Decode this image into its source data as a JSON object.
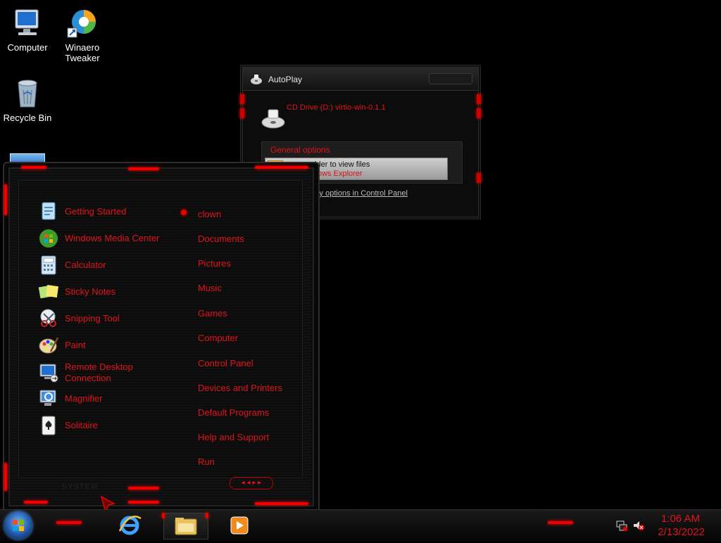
{
  "desktop": {
    "icons": [
      {
        "label": "Computer",
        "icon": "computer-icon"
      },
      {
        "label": "Winaero Tweaker",
        "icon": "winaero-tweaker-icon"
      },
      {
        "label": "Recycle Bin",
        "icon": "recycle-bin-icon"
      }
    ]
  },
  "autoplay": {
    "title": "AutoPlay",
    "drive": "CD Drive (D:) virtio-win-0.1.1",
    "group_title": "General options",
    "option_line1": "older to view files",
    "option_line2": "ows Explorer",
    "control_panel_link": "lay options in Control Panel"
  },
  "start_menu": {
    "programs": [
      {
        "label": "Getting Started",
        "icon": "getting-started-icon"
      },
      {
        "label": "Windows Media Center",
        "icon": "media-center-icon"
      },
      {
        "label": "Calculator",
        "icon": "calculator-icon"
      },
      {
        "label": "Sticky Notes",
        "icon": "sticky-notes-icon"
      },
      {
        "label": "Snipping Tool",
        "icon": "snipping-tool-icon"
      },
      {
        "label": "Paint",
        "icon": "paint-icon"
      },
      {
        "label": "Remote Desktop",
        "label2": "Connection",
        "icon": "remote-desktop-icon"
      },
      {
        "label": "Magnifier",
        "icon": "magnifier-icon"
      },
      {
        "label": "Solitaire",
        "icon": "solitaire-icon"
      }
    ],
    "places": [
      "clown",
      "Documents",
      "Pictures",
      "Music",
      "Games",
      "Computer",
      "Control Panel",
      "Devices and Printers",
      "Default Programs",
      "Help and Support",
      "Run"
    ]
  },
  "taskbar": {
    "time": "1:06 AM",
    "date": "2/13/2022",
    "pinned": [
      "internet-explorer-icon",
      "windows-explorer-icon",
      "media-player-icon"
    ]
  },
  "colors": {
    "accent": "#e0141b",
    "background": "#000000"
  }
}
